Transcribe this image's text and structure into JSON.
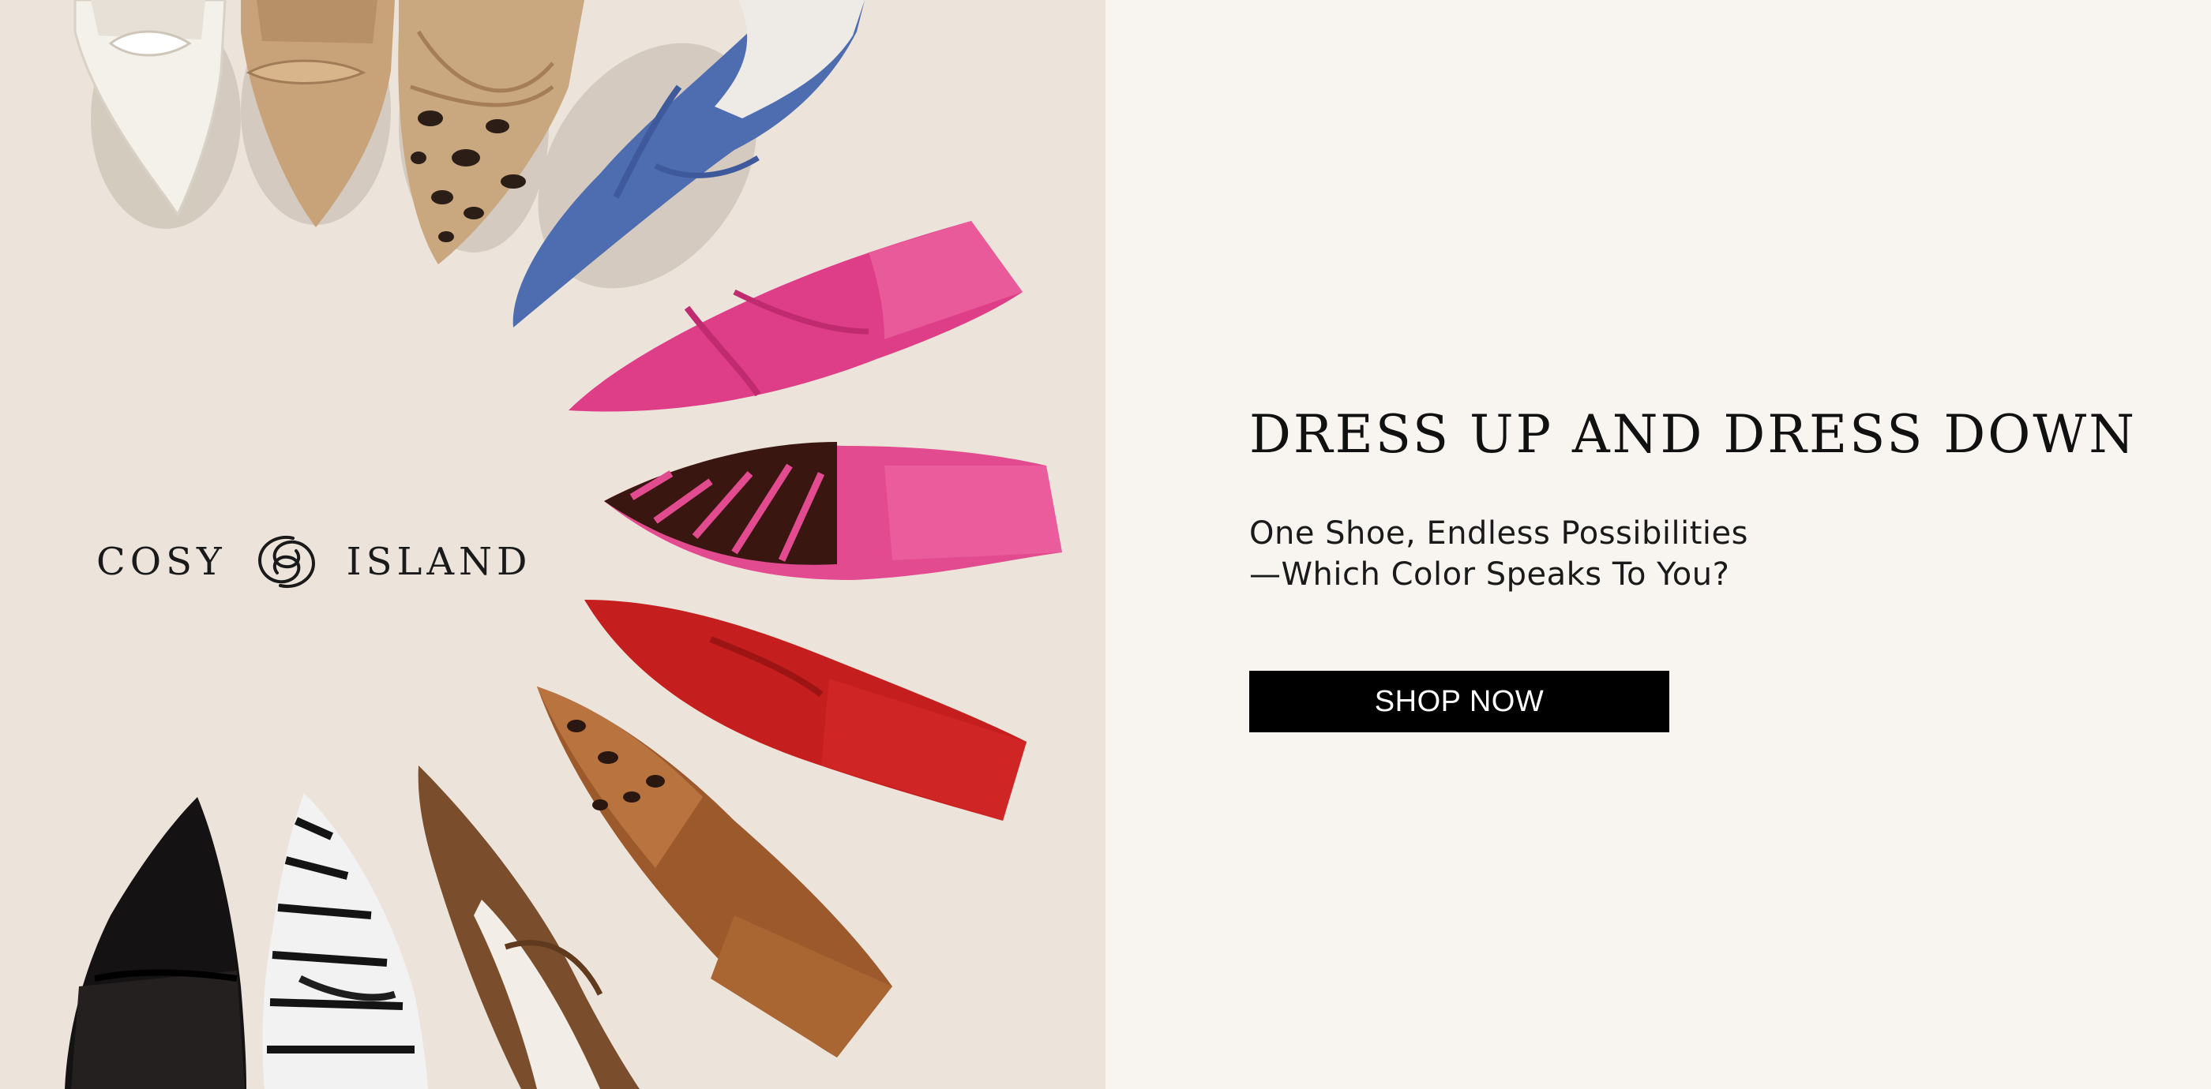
{
  "brand": {
    "left_word": "COSY",
    "right_word": "ISLAND"
  },
  "hero": {
    "headline": "DRESS UP AND DRESS DOWN",
    "subline_1": "One Shoe, Endless Possibilities",
    "subline_2": "—Which Color Speaks To You?",
    "cta_label": "SHOP NOW"
  },
  "colors": {
    "image_background": "#ece4da",
    "panel_background": "#f8f5f1",
    "text": "#111111",
    "button": "#000000",
    "button_text": "#ffffff"
  },
  "product_image": {
    "shoe_colors": [
      "white",
      "tan",
      "leopard",
      "blue",
      "pink",
      "pink-zebra",
      "red",
      "brown-leopard",
      "brown",
      "zebra",
      "black"
    ],
    "icons": [
      "shoe-circle-photo",
      "brand-monogram-icon"
    ]
  }
}
